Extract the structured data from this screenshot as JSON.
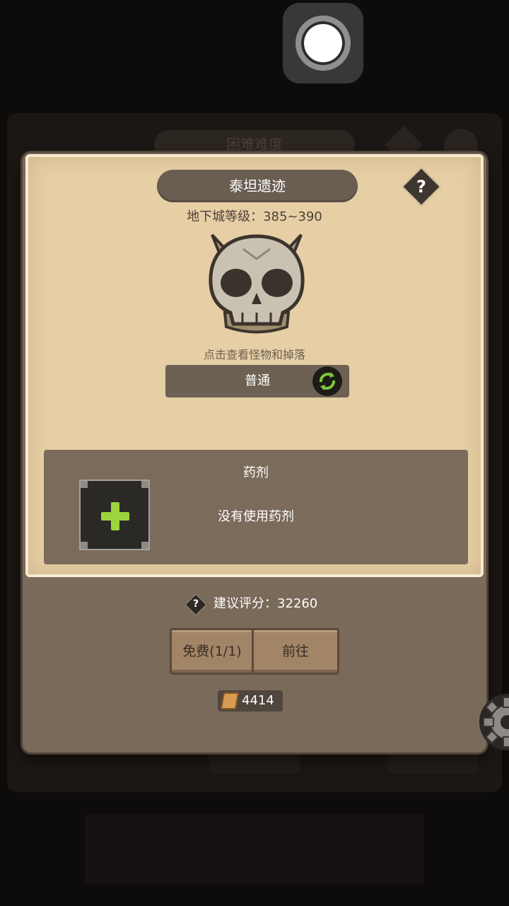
{
  "background": {
    "title": "困难难度"
  },
  "dungeon": {
    "name": "泰坦遗迹",
    "level_label": "地下城等级：385~390",
    "monster_hint": "点击查看怪物和掉落",
    "difficulty": "普通",
    "help_icon": "?"
  },
  "potion": {
    "title": "药剂",
    "status": "没有使用药剂"
  },
  "recommend": {
    "icon": "?",
    "label": "建议评分：32260"
  },
  "buttons": {
    "free": "免费(1/1)",
    "go": "前往"
  },
  "ticket": {
    "count": "4414"
  },
  "colors": {
    "accent_green": "#9bd43d",
    "parchment": "#e6cea5",
    "wood": "#a28467"
  }
}
